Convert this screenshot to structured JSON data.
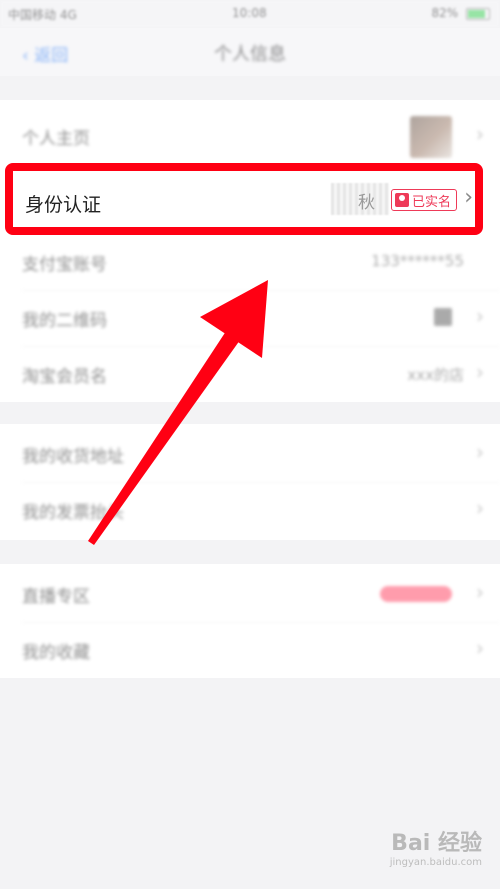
{
  "status_bar": {
    "carrier": "中国移动 4G",
    "time": "10:08",
    "battery": "82%"
  },
  "nav": {
    "back_label": "返回",
    "title": "个人信息"
  },
  "section1": {
    "rows": [
      {
        "label": "个人主页"
      },
      {
        "label": "身份认证",
        "value_char": "秋",
        "badge": "已实名"
      },
      {
        "label": "支付宝账号",
        "value": "133******55"
      },
      {
        "label": "我的二维码"
      },
      {
        "label": "淘宝会员名",
        "value": "xxx的店"
      }
    ]
  },
  "section2": {
    "rows": [
      {
        "label": "我的收货地址"
      },
      {
        "label": "我的发票抬头"
      }
    ]
  },
  "section3": {
    "rows": [
      {
        "label": "直播专区"
      },
      {
        "label": "我的收藏"
      }
    ]
  },
  "chevron": "›",
  "watermark": {
    "brand": "Bai 经验",
    "sub": "jingyan.baidu.com"
  },
  "colors": {
    "highlight": "#ff0013",
    "badge": "#ee3a58",
    "back": "#2e7cf6",
    "arrow": "#ff0013"
  }
}
